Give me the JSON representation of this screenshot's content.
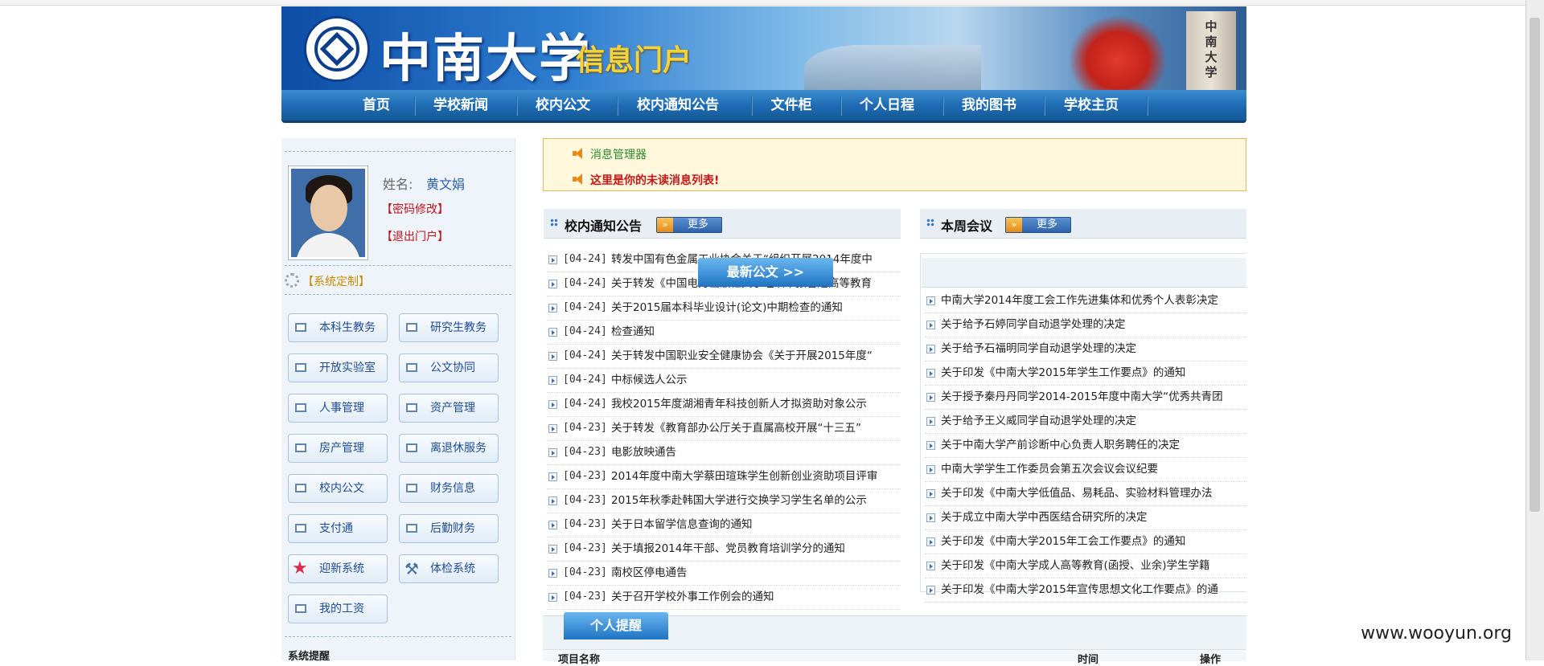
{
  "banner": {
    "school_name": "中南大学",
    "portal_name": "信息门户",
    "tower_text": "中南大学"
  },
  "nav": {
    "items": [
      {
        "label": "首页"
      },
      {
        "label": "学校新闻"
      },
      {
        "label": "校内公文"
      },
      {
        "label": "校内通知公告"
      },
      {
        "label": "文件柜"
      },
      {
        "label": "个人日程"
      },
      {
        "label": "我的图书"
      },
      {
        "label": "学校主页"
      }
    ]
  },
  "user": {
    "name_label": "姓名:",
    "name": "黄文娟",
    "change_password": "【密码修改】",
    "logout": "【退出门户】",
    "system_custom": "【系统定制】"
  },
  "sidebar": {
    "buttons": [
      {
        "label": "本科生教务",
        "icon": "window-icon"
      },
      {
        "label": "研究生教务",
        "icon": "window-icon"
      },
      {
        "label": "开放实验室",
        "icon": "window-icon"
      },
      {
        "label": "公文协同",
        "icon": "window-icon"
      },
      {
        "label": "人事管理",
        "icon": "window-icon"
      },
      {
        "label": "资产管理",
        "icon": "window-icon"
      },
      {
        "label": "房产管理",
        "icon": "window-icon"
      },
      {
        "label": "离退休服务",
        "icon": "window-icon"
      },
      {
        "label": "校内公文",
        "icon": "window-icon"
      },
      {
        "label": "财务信息",
        "icon": "window-icon"
      },
      {
        "label": "支付通",
        "icon": "window-icon"
      },
      {
        "label": "后勤财务",
        "icon": "window-icon"
      },
      {
        "label": "迎新系统",
        "icon": "star-icon"
      },
      {
        "label": "体检系统",
        "icon": "tool-icon"
      },
      {
        "label": "我的工资",
        "icon": "window-icon"
      }
    ],
    "system_reminder": "系统提醒"
  },
  "notice": {
    "line1": "消息管理器",
    "line2": "这里是你的未读消息列表!"
  },
  "notices_panel": {
    "title": "校内通知公告",
    "more": "更多",
    "items": [
      {
        "date": "[04-24]",
        "title": "转发中国有色金属工业协会关于“组织开展2014年度中"
      },
      {
        "date": "[04-24]",
        "title": "关于转发《中国电力出版社关于组织申报普通高等教育"
      },
      {
        "date": "[04-24]",
        "title": "关于2015届本科毕业设计(论文)中期检查的通知"
      },
      {
        "date": "[04-24]",
        "title": "检查通知"
      },
      {
        "date": "[04-24]",
        "title": "关于转发中国职业安全健康协会《关于开展2015年度“"
      },
      {
        "date": "[04-24]",
        "title": "中标候选人公示"
      },
      {
        "date": "[04-24]",
        "title": "我校2015年度湖湘青年科技创新人才拟资助对象公示"
      },
      {
        "date": "[04-23]",
        "title": "关于转发《教育部办公厅关于直属高校开展“十三五”"
      },
      {
        "date": "[04-23]",
        "title": "电影放映通告"
      },
      {
        "date": "[04-23]",
        "title": "2014年度中南大学蔡田瑄珠学生创新创业资助项目评审"
      },
      {
        "date": "[04-23]",
        "title": "2015年秋季赴韩国大学进行交换学习学生名单的公示"
      },
      {
        "date": "[04-23]",
        "title": "关于日本留学信息查询的通知"
      },
      {
        "date": "[04-23]",
        "title": "关于填报2014年干部、党员教育培训学分的通知"
      },
      {
        "date": "[04-23]",
        "title": "南校区停电通告"
      },
      {
        "date": "[04-23]",
        "title": "关于召开学校外事工作例会的通知"
      }
    ]
  },
  "meetings_panel": {
    "title": "本周会议",
    "more": "更多",
    "latest_tab": "最新公文 >>",
    "items": [
      "中南大学2014年度工会工作先进集体和优秀个人表彰决定",
      "关于给予石婷同学自动退学处理的决定",
      "关于给予石福明同学自动退学处理的决定",
      "关于印发《中南大学2015年学生工作要点》的通知",
      "关于授予秦丹丹同学2014-2015年度中南大学“优秀共青团",
      "关于给予王义威同学自动退学处理的决定",
      "关于中南大学产前诊断中心负责人职务聘任的决定",
      "中南大学学生工作委员会第五次会议会议纪要",
      "关于印发《中南大学低值品、易耗品、实验材料管理办法",
      "关于成立中南大学中西医结合研究所的决定",
      "关于印发《中南大学2015年工会工作要点》的通知",
      "关于印发《中南大学成人高等教育(函授、业余)学生学籍",
      "关于印发《中南大学2015年宣传思想文化工作要点》的通"
    ]
  },
  "personal": {
    "tab": "个人提醒",
    "col_name": "项目名称",
    "col_time": "时间",
    "col_action": "操作"
  },
  "watermark": "www.wooyun.org"
}
